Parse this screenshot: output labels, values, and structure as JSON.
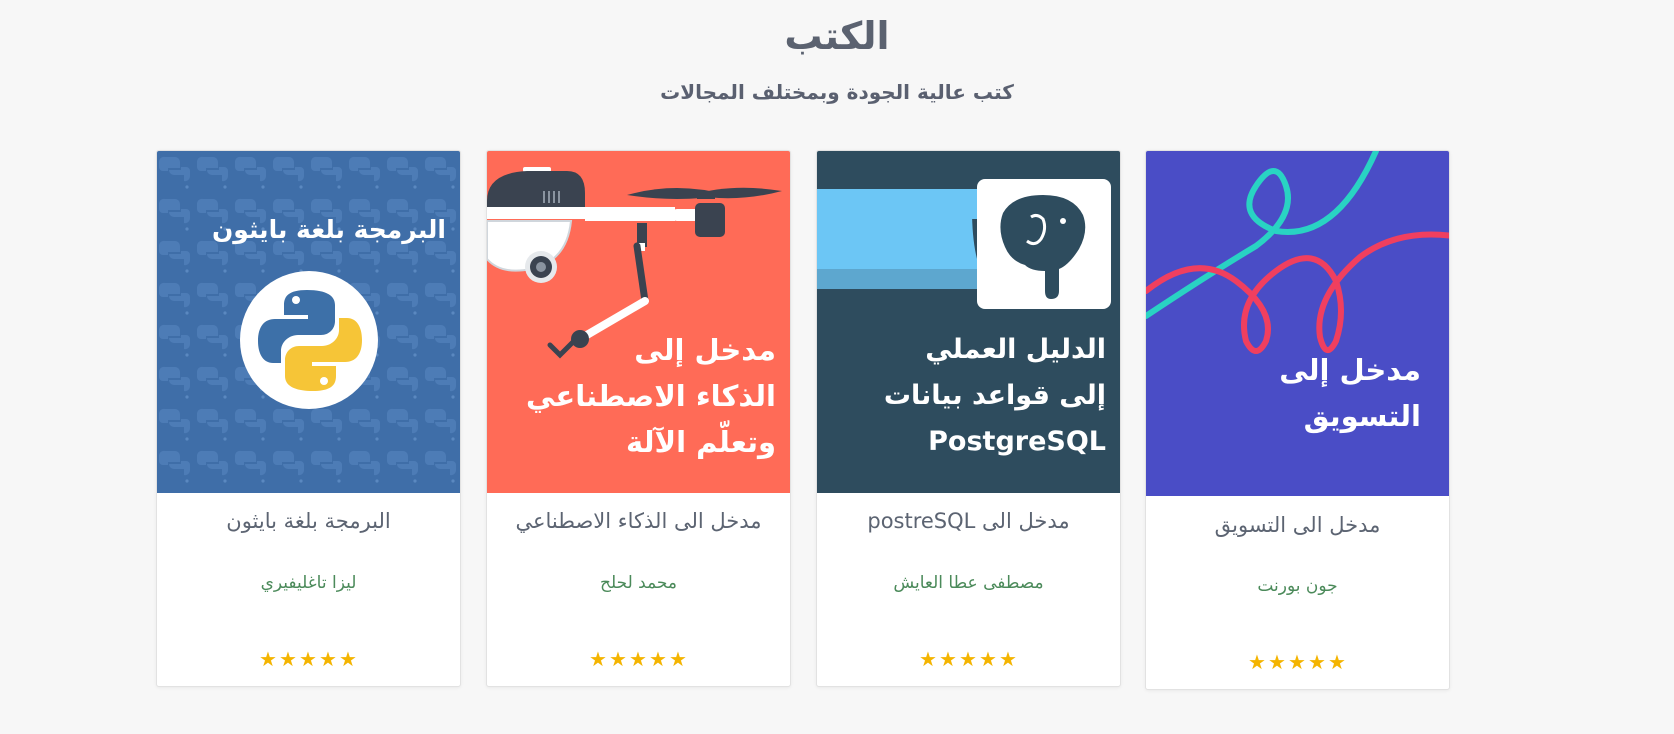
{
  "section": {
    "title": "الكتب",
    "subtitle": "كتب عالية الجودة وبمختلف المجالات"
  },
  "books": [
    {
      "cover_text": "البرمجة بلغة بايثون",
      "cover_color": "#3f6ea8",
      "title": "البرمجة بلغة بايثون",
      "author": "ليزا تاغليفيري",
      "rating": 5
    },
    {
      "cover_text": "مدخل إلى\nالذكاء الاصطناعي\nوتعلّم الآلة",
      "cover_color": "#ff6b57",
      "title": "مدخل الى الذكاء الاصطناعي",
      "author": "محمد لحلح",
      "rating": 5
    },
    {
      "cover_text": "الدليل العملي\nإلى قواعد بيانات\nPostgreSQL",
      "cover_color": "#2e4c5e",
      "title": "مدخل الى postreSQL",
      "author": "مصطفى عطا العايش",
      "rating": 5
    },
    {
      "cover_text": "مدخل إلى\nالتسويق",
      "cover_color": "#4a4dc6",
      "title": "مدخل الى التسويق",
      "author": "جون بورنت",
      "rating": 5
    }
  ],
  "colors": {
    "star": "#f4b400",
    "author": "#4b8a5a",
    "title": "#5c6472"
  },
  "icons": {
    "rating": "star-icon",
    "python": "python-logo-icon",
    "postgres": "elephant-icon",
    "drone": "drone-icon"
  }
}
